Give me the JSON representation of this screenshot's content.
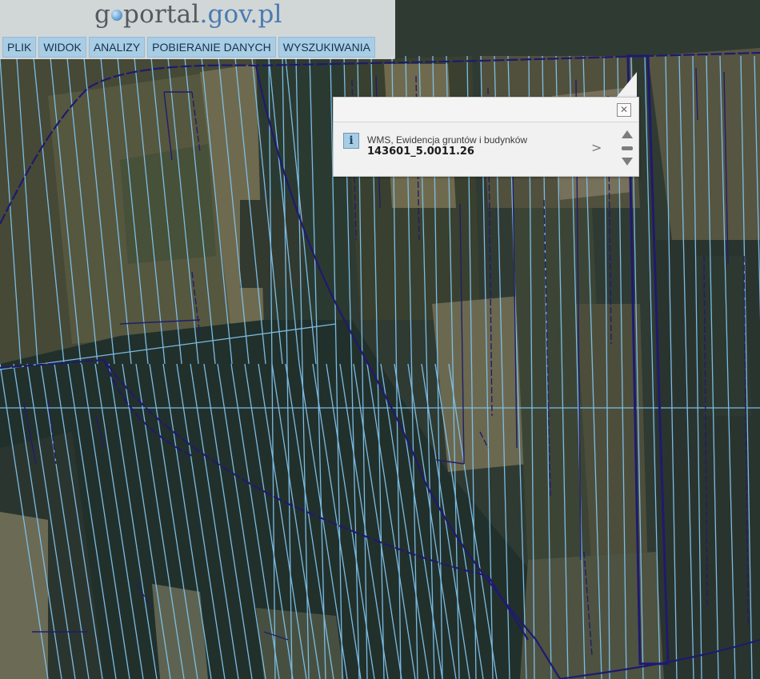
{
  "header": {
    "logo": {
      "part1": "g",
      "part2": "o",
      "part3": "portal",
      "part4": ".gov.pl"
    },
    "menu": [
      "PLIK",
      "WIDOK",
      "ANALIZY",
      "POBIERANIE DANYCH",
      "WYSZUKIWANIA"
    ]
  },
  "popup": {
    "layer_name": "WMS, Ewidencja gruntów i budynków",
    "parcel_id": "143601_5.0011.26",
    "info_icon": "info-icon",
    "close_icon": "close-icon",
    "details_icon": "chevron-right-icon"
  },
  "map": {
    "basemap": "orthophoto",
    "colors": {
      "parcel_lines": "#7fc3ee",
      "boundary_lines": "#1f1a6e",
      "forest": "#27362f",
      "field": "#5c5a44"
    }
  }
}
